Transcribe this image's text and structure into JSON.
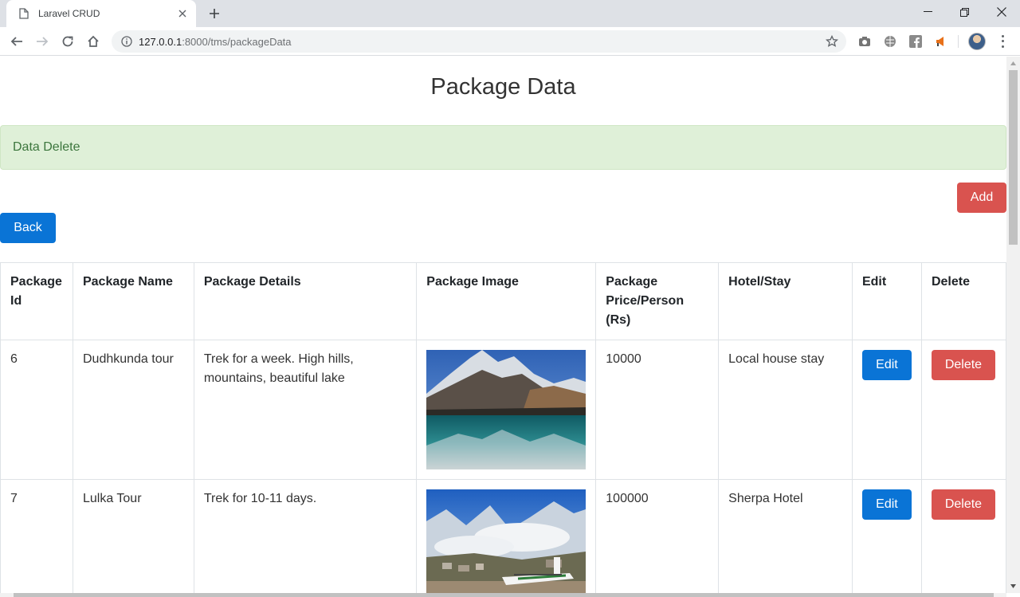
{
  "browser": {
    "tab_title": "Laravel CRUD",
    "url_host": "127.0.0.1",
    "url_rest": ":8000/tms/packageData"
  },
  "page": {
    "title": "Package Data",
    "alert": "Data Delete",
    "add_label": "Add",
    "back_label": "Back"
  },
  "table": {
    "headers": [
      "Package Id",
      "Package Name",
      "Package Details",
      "Package Image",
      "Package Price/Person (Rs)",
      "Hotel/Stay",
      "Edit",
      "Delete"
    ],
    "rows": [
      {
        "id": "6",
        "name": "Dudhkunda tour",
        "details": "Trek for a week. High hills, mountains, beautiful lake",
        "image": "mountain-lake-photo",
        "price": "10000",
        "hotel": "Local house stay",
        "edit": "Edit",
        "delete": "Delete"
      },
      {
        "id": "7",
        "name": "Lulka Tour",
        "details": "Trek for 10-11 days.",
        "image": "mountain-airstrip-photo",
        "price": "100000",
        "hotel": "Sherpa Hotel",
        "edit": "Edit",
        "delete": "Delete"
      }
    ]
  },
  "colors": {
    "primary": "#0a74d6",
    "danger": "#d9534f",
    "alert_bg": "#dff0d8",
    "alert_text": "#3c763d"
  }
}
